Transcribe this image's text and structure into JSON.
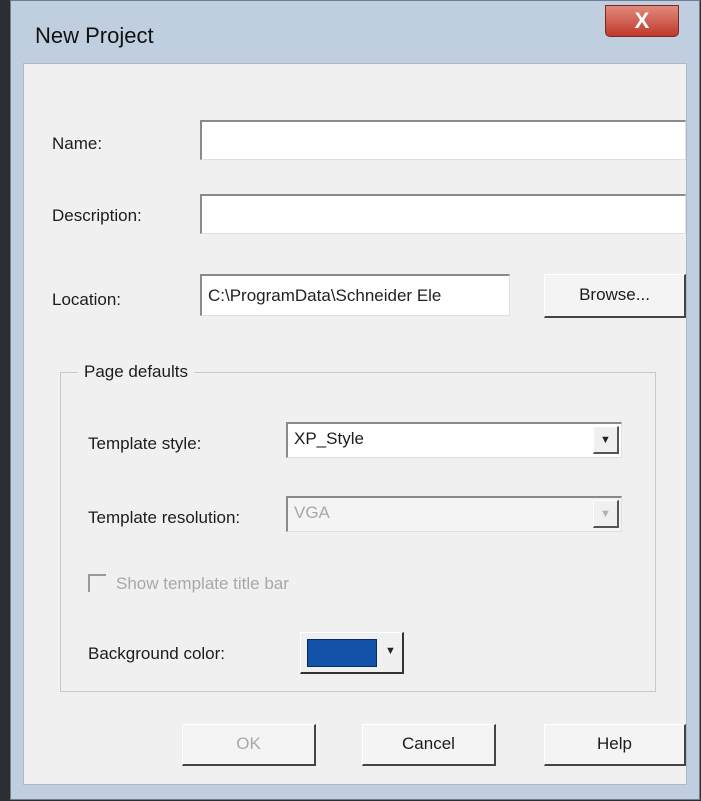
{
  "window": {
    "title": "New Project",
    "close_label": "X"
  },
  "form": {
    "name_label": "Name:",
    "name_value": "",
    "description_label": "Description:",
    "description_value": "",
    "location_label": "Location:",
    "location_value": "C:\\ProgramData\\Schneider Ele",
    "browse_label": "Browse..."
  },
  "page_defaults": {
    "group_label": "Page defaults",
    "template_style_label": "Template style:",
    "template_style_value": "XP_Style",
    "template_resolution_label": "Template resolution:",
    "template_resolution_value": "VGA",
    "show_title_bar_label": "Show template title bar",
    "show_title_bar_checked": false,
    "background_color_label": "Background color:",
    "background_color": "#1252a8"
  },
  "buttons": {
    "ok_label": "OK",
    "cancel_label": "Cancel",
    "help_label": "Help"
  },
  "icons": {
    "dropdown": "chevron-down-icon",
    "close": "close-icon"
  },
  "colors": {
    "window_frame": "#bfcfdf",
    "client_bg": "#f0f0f0",
    "close_button": "#c0392b"
  }
}
